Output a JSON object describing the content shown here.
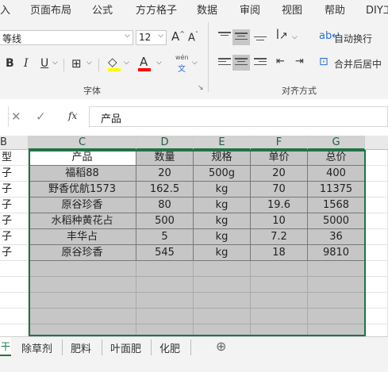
{
  "menu": [
    "入",
    "页面布局",
    "公式",
    "方方格子",
    "数据",
    "审阅",
    "视图",
    "帮助",
    "DIY工"
  ],
  "ribbon": {
    "font_name": "等线",
    "font_size": "12",
    "grow_font": "A",
    "shrink_font": "A",
    "bold": "B",
    "italic": "I",
    "underline": "U",
    "font_color_letter": "A",
    "phonetic": "wén",
    "phonetic_sub": "文",
    "wrap_text": "自动换行",
    "merge_center": "合并后居中",
    "font_group": "字体",
    "align_group": "对齐方式",
    "colors": {
      "highlight": "#ffff00",
      "font_color": "#ff0000"
    }
  },
  "formula_bar": {
    "fx": "fx",
    "content": "产品"
  },
  "columns": [
    "B",
    "C",
    "D",
    "E",
    "F",
    "G"
  ],
  "partial_col_b": [
    "型",
    "子",
    "子",
    "子",
    "子",
    "子",
    "子"
  ],
  "table": {
    "headers": [
      "产品",
      "数量",
      "规格",
      "单价",
      "总价"
    ],
    "rows": [
      [
        "福稻88",
        "20",
        "500g",
        "20",
        "400"
      ],
      [
        "野香优航1573",
        "162.5",
        "kg",
        "70",
        "11375"
      ],
      [
        "原谷珍香",
        "80",
        "kg",
        "19.6",
        "1568"
      ],
      [
        "水稻种黄花占",
        "500",
        "kg",
        "10",
        "5000"
      ],
      [
        "丰华占",
        "5",
        "kg",
        "7.2",
        "36"
      ],
      [
        "原谷珍香",
        "545",
        "kg",
        "18",
        "9810"
      ]
    ]
  },
  "sheet_tabs": [
    "除草剂",
    "肥料",
    "叶面肥",
    "化肥"
  ],
  "add_sheet": "⊕",
  "accent": "#217346"
}
